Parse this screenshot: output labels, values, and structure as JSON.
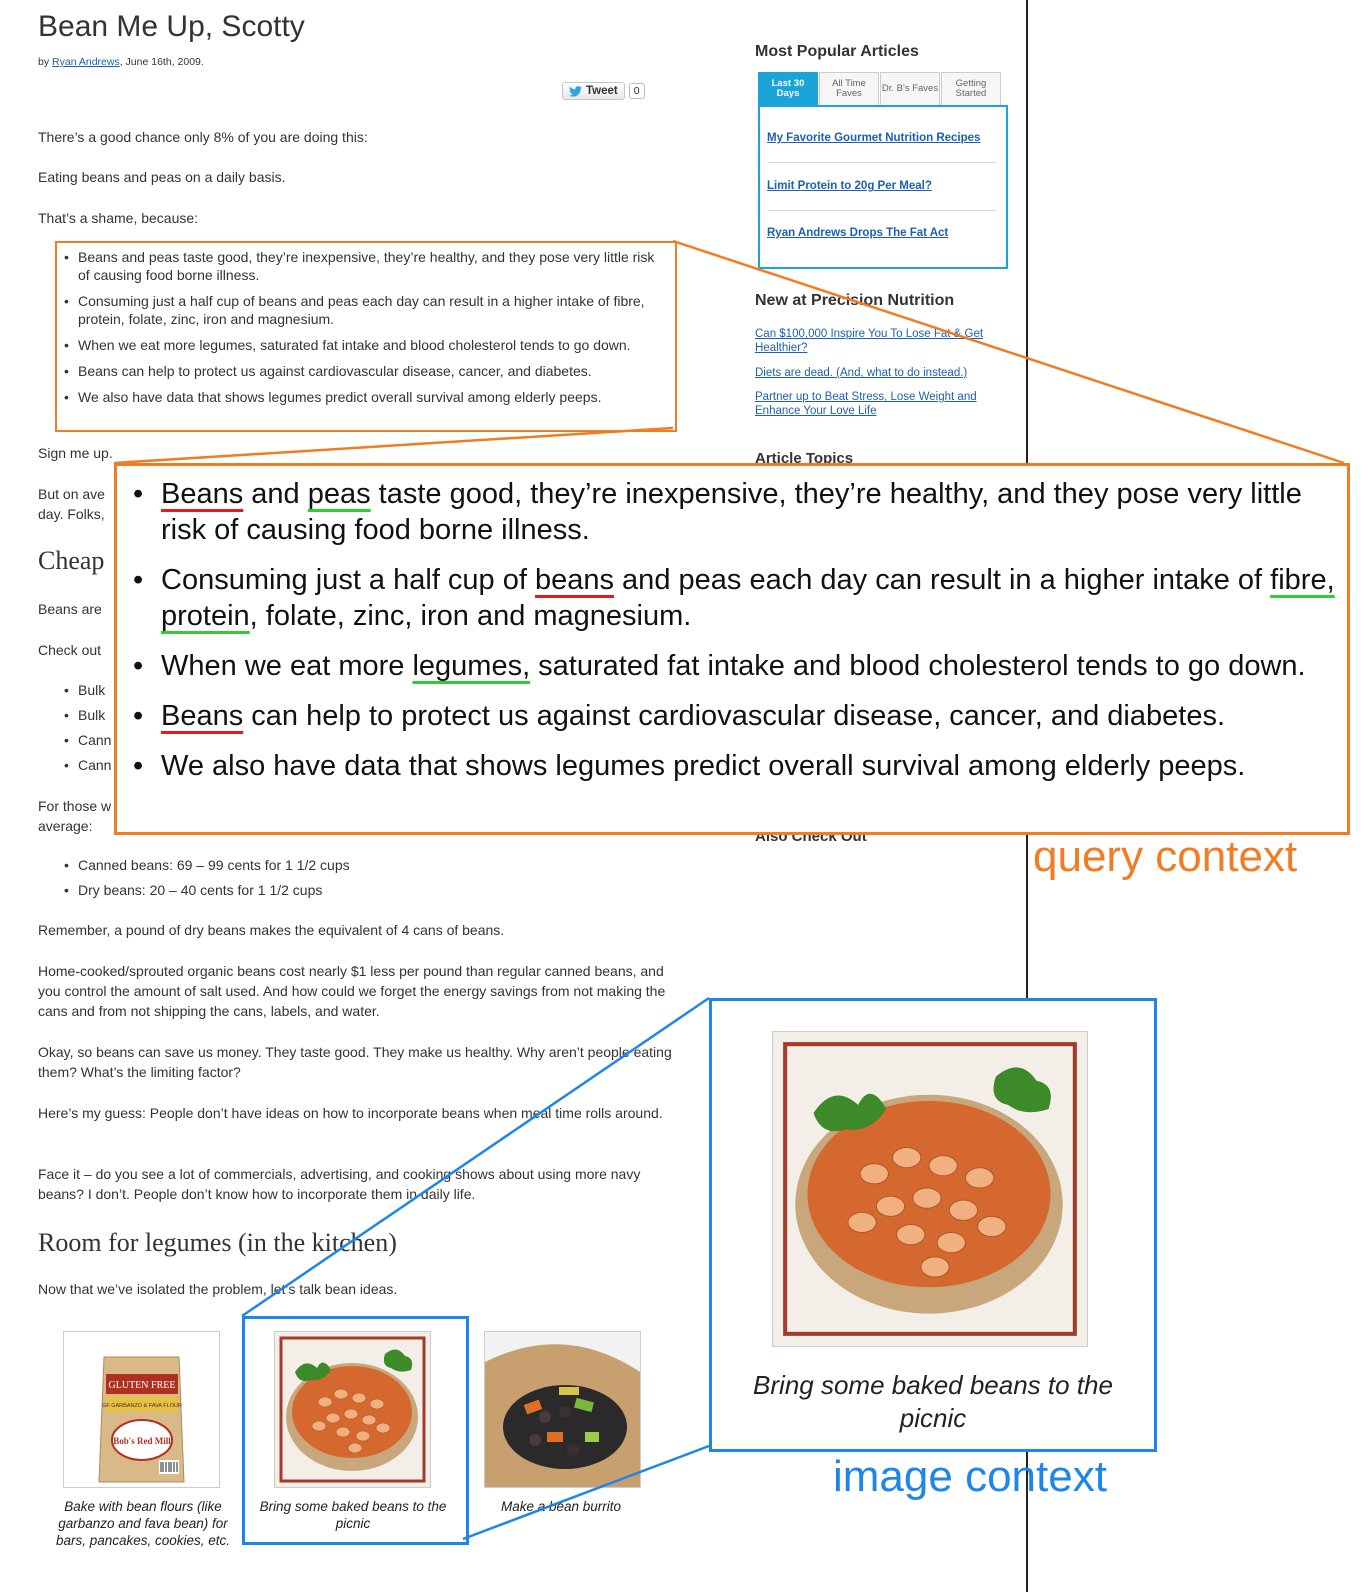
{
  "article": {
    "title": "Bean Me Up, Scotty",
    "by": "by",
    "author": "Ryan Andrews",
    "date": ", June 16th, 2009.",
    "tweet_label": "Tweet",
    "tweet_count": "0",
    "p1": "There’s a good chance only 8% of you are doing this:",
    "p2": "Eating beans and peas on a daily basis.",
    "p3": "That’s a shame, because:",
    "bullets": [
      "Beans and peas taste good, they’re inexpensive, they’re healthy, and they pose very little risk of causing food borne illness.",
      "Consuming just a half cup of beans and peas each day can result in a higher intake of fibre, protein, folate, zinc, iron and magnesium.",
      "When we eat more legumes, saturated fat intake and blood cholesterol tends to go down.",
      "Beans can help to protect us against cardiovascular disease, cancer, and diabetes.",
      "We also have data that shows legumes predict overall survival among elderly peeps."
    ],
    "sign": "Sign me up.",
    "avg_a": "But on ave",
    "avg_b": "day. Folks,",
    "cheap_heading": "Cheap",
    "beans_are": "Beans are",
    "check_out": "Check out",
    "partial_items": [
      "Bulk",
      "Bulk",
      "Cann",
      "Cann"
    ],
    "for_those_a": "For those w",
    "for_those_b": "average:",
    "price_items": [
      "Canned beans: 69 – 99 cents for 1 1/2 cups",
      "Dry beans: 20 – 40 cents for 1 1/2 cups"
    ],
    "remember": "Remember, a pound of dry beans makes the equivalent of 4 cans of beans.",
    "home_cooked": "Home-cooked/sprouted organic beans cost nearly $1 less per pound than regular canned beans, and you control the amount of salt used. And how could we forget the energy savings from not making the cans and from not shipping the cans, labels, and water.",
    "okay": "Okay, so beans can save us money. They taste good. They make us healthy. Why aren’t people eating them? What’s the limiting factor?",
    "guess": "Here’s my guess: People don’t have ideas on how to incorporate beans when meal time rolls around.",
    "face_it": "Face it – do you see a lot of commercials, advertising, and cooking shows about using more navy beans? I don’t. People don’t know how to incorporate them in daily life.",
    "room_heading": "Room for legumes (in the kitchen)",
    "now_that": "Now that we’ve isolated the problem, let’s talk bean ideas.",
    "captions": [
      "Bake with bean flours (like garbanzo and fava bean) for bars, pancakes, cookies, etc.",
      "Bring some baked beans to the picnic",
      "Make a bean burrito"
    ],
    "bag_text": [
      "GLUTEN FREE",
      "GF GARBANZO & FAVA FLOUR",
      "Bob's Red Mill"
    ]
  },
  "sidebar": {
    "popular_title": "Most Popular Articles",
    "tabs": [
      "Last 30 Days",
      "All Time Faves",
      "Dr. B's Faves",
      "Getting Started"
    ],
    "popular_links": [
      "My Favorite Gourmet Nutrition Recipes",
      "Limit Protein to 20g Per Meal?",
      "Ryan Andrews Drops The Fat Act"
    ],
    "new_title": "New at Precision Nutrition",
    "new_links": [
      "Can $100,000 Inspire You To Lose Fat & Get Healthier?",
      "Diets are dead. (And, what to do instead.)",
      "Partner up to Beat Stress, Lose Weight and Enhance Your Love Life"
    ],
    "topics_title": "Article Topics",
    "also_title": "Also Check Out"
  },
  "annotation": {
    "query_label": "query context",
    "image_label": "image context",
    "zoom_caption": "Bring some baked beans to the picnic",
    "colors": {
      "query": "#f07c23",
      "image": "#1e86e8",
      "red_underline": "#e31b1b",
      "green_underline": "#2fcd2f"
    }
  }
}
